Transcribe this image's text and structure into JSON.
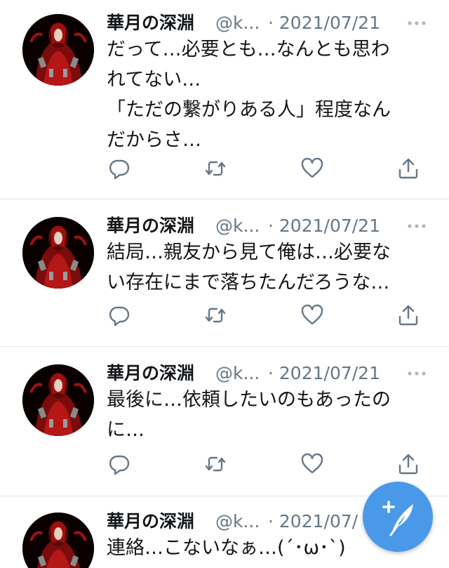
{
  "colors": {
    "accent": "#1da1f2",
    "fab": "#4a99e9",
    "muted": "#657786",
    "text": "#14171a",
    "divider": "#e1e8ed"
  },
  "tweets": [
    {
      "name": "華月の深淵",
      "handle": "@k...",
      "date": "· 2021/07/21",
      "lines": [
        "だって…必要とも…なんとも思わ",
        "れてない…",
        "「ただの繋がりある人」程度なん",
        "だからさ…"
      ]
    },
    {
      "name": "華月の深淵",
      "handle": "@k...",
      "date": "· 2021/07/21",
      "lines": [
        "結局…親友から見て俺は…必要な",
        "い存在にまで落ちたんだろうな…"
      ]
    },
    {
      "name": "華月の深淵",
      "handle": "@k...",
      "date": "· 2021/07/21",
      "lines": [
        "最後に…依頼したいのもあったの",
        "に…"
      ]
    },
    {
      "name": "華月の深淵",
      "handle": "@k...",
      "date": "· 2021/07/",
      "lines": [
        "連絡…こないなぁ…(´･ω･`)"
      ]
    }
  ],
  "icons": {
    "reply": "reply-icon",
    "retweet": "retweet-icon",
    "like": "heart-icon",
    "share": "share-icon",
    "more": "more-icon",
    "compose": "compose-tweet-icon"
  }
}
